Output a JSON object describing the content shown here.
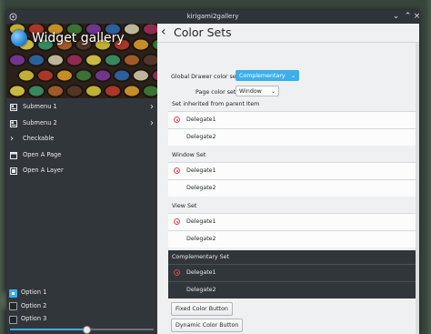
{
  "window": {
    "title": "kirigami2gallery"
  },
  "drawer": {
    "title": "Widget gallery",
    "items": [
      {
        "label": "Submenu 1",
        "icon": "submenu-icon",
        "has_chevron": true
      },
      {
        "label": "Submenu 2",
        "icon": "submenu-icon",
        "has_chevron": true
      },
      {
        "label": "Checkable",
        "icon": "chevron-right-icon",
        "has_chevron": false
      },
      {
        "label": "Open A Page",
        "icon": "page-icon",
        "has_chevron": false
      },
      {
        "label": "Open A Layer",
        "icon": "layer-icon",
        "has_chevron": false
      }
    ],
    "options": [
      {
        "label": "Option 1",
        "checked": true
      },
      {
        "label": "Option 2",
        "checked": false
      },
      {
        "label": "Option 3",
        "checked": false
      }
    ],
    "slider_value": 0.53
  },
  "page": {
    "title": "Color Sets",
    "global_label": "Global Drawer color set:",
    "global_value": "Complementary",
    "page_label": "Page color set:",
    "page_value": "Window",
    "sections": [
      {
        "header": "Set inherited from parent Item",
        "items": [
          "Delegate1",
          "Delegate2"
        ],
        "dark": false
      },
      {
        "header": "Window Set",
        "items": [
          "Delegate1",
          "Delegate2"
        ],
        "dark": false
      },
      {
        "header": "View Set",
        "items": [
          "Delegate1",
          "Delegate2"
        ],
        "dark": false
      },
      {
        "header": "Complementary Set",
        "items": [
          "Delegate1",
          "Delegate2"
        ],
        "dark": true
      }
    ],
    "fixed_button": "Fixed Color Button",
    "dynamic_button": "Dynamic Color Button"
  },
  "colors": {
    "accent": "#3daee9",
    "drawer_bg": "#31363b",
    "radio": "#da4453"
  }
}
